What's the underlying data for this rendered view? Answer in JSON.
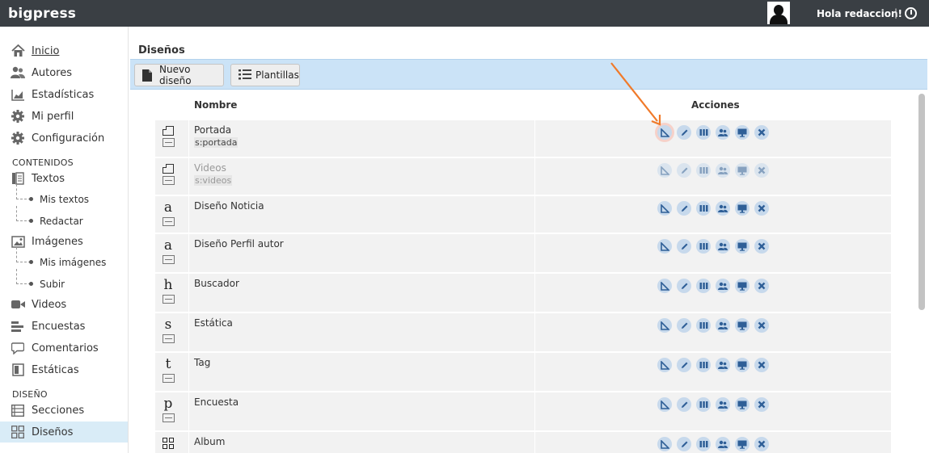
{
  "app": {
    "brand": "bigpress",
    "greeting": "Hola redaccion!",
    "separator": "|"
  },
  "sidebar": {
    "items": [
      {
        "label": "Inicio",
        "icon": "home-icon"
      },
      {
        "label": "Autores",
        "icon": "users-icon"
      },
      {
        "label": "Estadísticas",
        "icon": "stats-icon"
      },
      {
        "label": "Mi perfil",
        "icon": "gear-icon"
      },
      {
        "label": "Configuración",
        "icon": "gear-icon"
      }
    ],
    "contenidos_heading": "CONTENIDOS",
    "textos": {
      "label": "Textos",
      "sub": [
        "Mis textos",
        "Redactar"
      ]
    },
    "imagenes": {
      "label": "Imágenes",
      "sub": [
        "Mis imágenes",
        "Subir"
      ]
    },
    "more": [
      {
        "label": "Videos"
      },
      {
        "label": "Encuestas"
      },
      {
        "label": "Comentarios"
      },
      {
        "label": "Estáticas"
      }
    ],
    "diseno_heading": "DISEÑO",
    "secciones": "Secciones",
    "disenos": "Diseños"
  },
  "main": {
    "title": "Diseños",
    "toolbar": {
      "new_label": "Nuevo diseño",
      "templates_label": "Plantillas"
    },
    "columns": {
      "name": "Nombre",
      "actions": "Acciones"
    },
    "rows": [
      {
        "glyph": "",
        "type": "page",
        "name": "Portada",
        "slug": "s:portada",
        "dim": false
      },
      {
        "glyph": "",
        "type": "page",
        "name": "Videos",
        "slug": "s:videos",
        "dim": true
      },
      {
        "glyph": "a",
        "type": "letter",
        "name": "Diseño Noticia",
        "slug": "",
        "dim": false
      },
      {
        "glyph": "a",
        "type": "letter",
        "name": "Diseño Perfil autor",
        "slug": "",
        "dim": false
      },
      {
        "glyph": "h",
        "type": "letter",
        "name": "Buscador",
        "slug": "",
        "dim": false
      },
      {
        "glyph": "s",
        "type": "letter",
        "name": "Estática",
        "slug": "",
        "dim": false
      },
      {
        "glyph": "t",
        "type": "letter",
        "name": "Tag",
        "slug": "",
        "dim": false
      },
      {
        "glyph": "p",
        "type": "letter",
        "name": "Encuesta",
        "slug": "",
        "dim": false
      },
      {
        "glyph": "",
        "type": "grid",
        "name": "Album",
        "slug": "",
        "dim": false
      }
    ],
    "action_icons": [
      "set-square-icon",
      "pencil-icon",
      "columns-icon",
      "users-icon",
      "monitor-icon",
      "close-icon"
    ],
    "colors": {
      "topbar": "#3a3f44",
      "toolbar": "#cbe3f7",
      "action": "#c7d9ec",
      "action_glyph": "#2f5f97",
      "arrow": "#f07a2a",
      "active_nav": "#d9ecf7"
    }
  }
}
